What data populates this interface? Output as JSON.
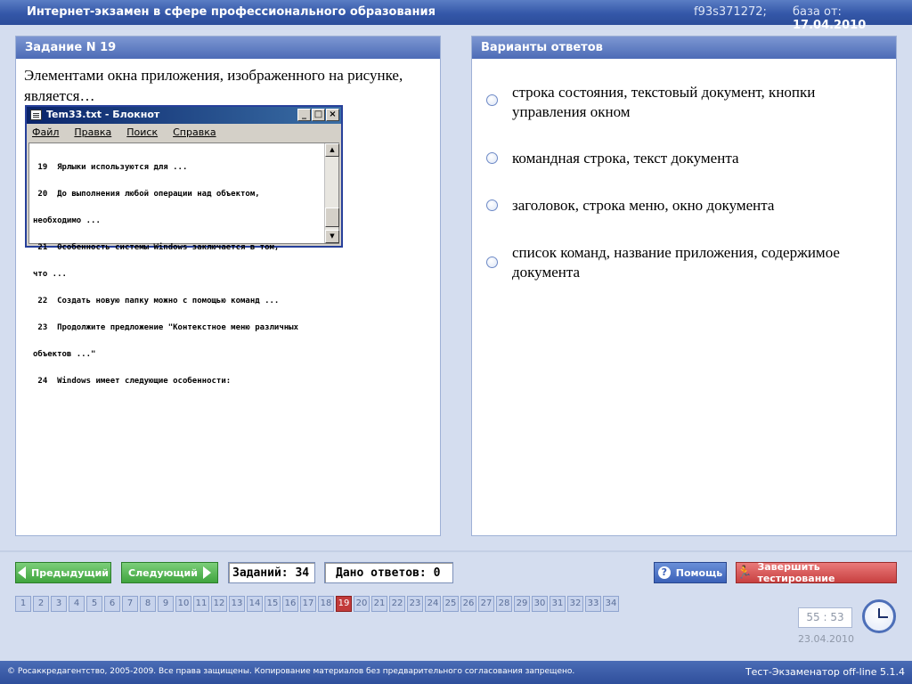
{
  "header": {
    "title": "Интернет-экзамен в сфере профессионального образования",
    "code": "f93s371272;",
    "base_label": "база от:",
    "base_date": "17.04.2010"
  },
  "task": {
    "heading": "Задание N 19",
    "question": "Элементами окна приложения, изображенного на рисунке, является…"
  },
  "notepad": {
    "title": "Tem33.txt - Блокнот",
    "menu": [
      "Файл",
      "Правка",
      "Поиск",
      "Справка"
    ],
    "lines": [
      " 19  Ярлыки используются для ...",
      " 20  До выполнения любой операции над объектом,",
      "необходимо ...",
      " 21  Особенность системы Windows заключается в том,",
      "что ...",
      " 22  Создать новую папку можно с помощью команд ...",
      " 23  Продолжите предложение \"Контекстное меню различных",
      "объектов ...\"",
      " 24  Windows имеет следующие особенности:"
    ]
  },
  "answers_panel": {
    "heading": "Варианты ответов",
    "options": [
      "строка состояния, текстовый документ, кнопки управления окном",
      "командная строка, текст документа",
      "заголовок, строка меню, окно документа",
      "список команд, название приложения, содержимое документа"
    ]
  },
  "nav": {
    "prev_label": "Предыдущий",
    "next_label": "Следующий",
    "tasks_count": "Заданий: 34",
    "answers_given": "Дано ответов: 0",
    "help_label": "Помощь",
    "finish_label": "Завершить тестирование"
  },
  "pager": {
    "pages": [
      "1",
      "2",
      "3",
      "4",
      "5",
      "6",
      "7",
      "8",
      "9",
      "10",
      "11",
      "12",
      "13",
      "14",
      "15",
      "16",
      "17",
      "18",
      "19",
      "20",
      "21",
      "22",
      "23",
      "24",
      "25",
      "26",
      "27",
      "28",
      "29",
      "30",
      "31",
      "32",
      "33",
      "34"
    ],
    "current": "19"
  },
  "timer": {
    "time": "55 : 53",
    "date": "23.04.2010"
  },
  "footer": {
    "copyright": "© Росаккредагентство, 2005-2009. Все права защищены. Копирование материалов без предварительного согласования запрещено.",
    "version": "Тест-Экзаменатор off-line 5.1.4"
  },
  "colors": {
    "accent": "#3457a8",
    "active_page": "#c23a3a",
    "green_button": "#3fa43e",
    "red_button": "#c84040"
  }
}
